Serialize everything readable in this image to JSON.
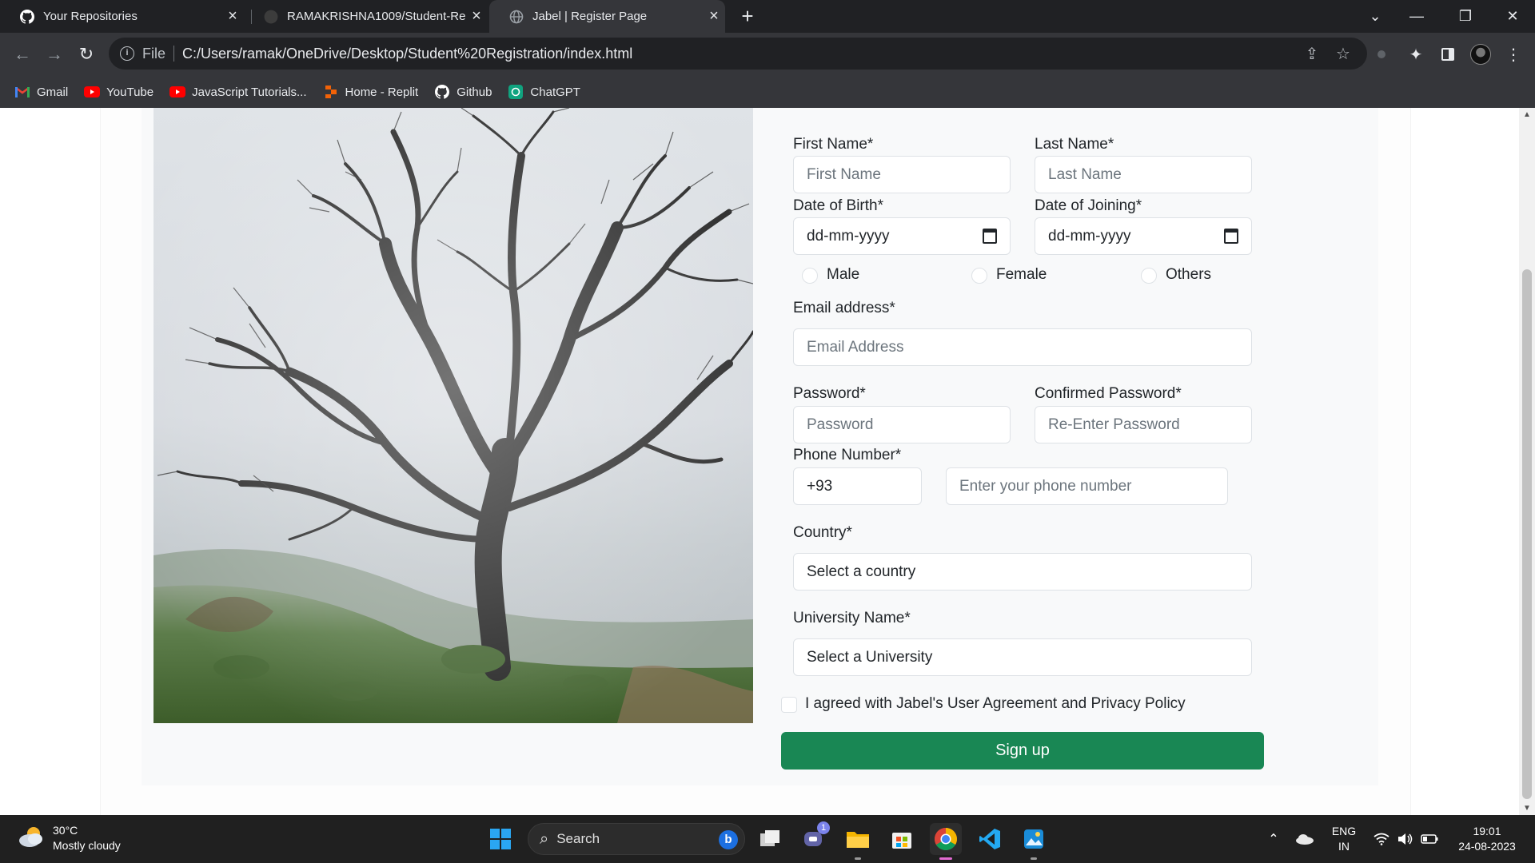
{
  "browser": {
    "tabs": [
      {
        "title": "Your Repositories",
        "icon": "github-icon"
      },
      {
        "title": "RAMAKRISHNA1009/Student-Re",
        "icon": "github-icon"
      },
      {
        "title": "Jabel | Register Page",
        "icon": "globe-icon",
        "active": true
      }
    ],
    "url_scheme": "File",
    "url": "C:/Users/ramak/OneDrive/Desktop/Student%20Registration/index.html",
    "bookmarks": [
      {
        "label": "Gmail",
        "icon": "gmail-icon"
      },
      {
        "label": "YouTube",
        "icon": "youtube-icon"
      },
      {
        "label": "JavaScript Tutorials...",
        "icon": "youtube-icon"
      },
      {
        "label": "Home - Replit",
        "icon": "replit-icon"
      },
      {
        "label": "Github",
        "icon": "github-icon"
      },
      {
        "label": "ChatGPT",
        "icon": "chatgpt-icon"
      }
    ]
  },
  "form": {
    "first_name": {
      "label": "First Name*",
      "placeholder": "First Name"
    },
    "last_name": {
      "label": "Last Name*",
      "placeholder": "Last Name"
    },
    "dob": {
      "label": "Date of Birth*",
      "placeholder": "dd-mm-yyyy"
    },
    "doj": {
      "label": "Date of Joining*",
      "placeholder": "dd-mm-yyyy"
    },
    "gender": [
      "Male",
      "Female",
      "Others"
    ],
    "email": {
      "label": "Email address*",
      "placeholder": "Email Address"
    },
    "password": {
      "label": "Password*",
      "placeholder": "Password"
    },
    "confirm_password": {
      "label": "Confirmed Password*",
      "placeholder": "Re-Enter Password"
    },
    "phone": {
      "label": "Phone Number*",
      "code": "+93",
      "placeholder": "Enter your phone number"
    },
    "country": {
      "label": "Country*",
      "value": "Select a country"
    },
    "university": {
      "label": "University Name*",
      "value": "Select a University"
    },
    "agreement": "I agreed with Jabel's User Agreement and Privacy Policy",
    "submit": "Sign up"
  },
  "taskbar": {
    "weather_temp": "30°C",
    "weather_desc": "Mostly cloudy",
    "search": "Search",
    "chat_badge": "1",
    "lang": "ENG",
    "region": "IN",
    "time": "19:01",
    "date": "24-08-2023"
  },
  "colors": {
    "submit": "#198754",
    "chrome_dark": "#202124",
    "chrome_toolbar": "#35363a"
  }
}
